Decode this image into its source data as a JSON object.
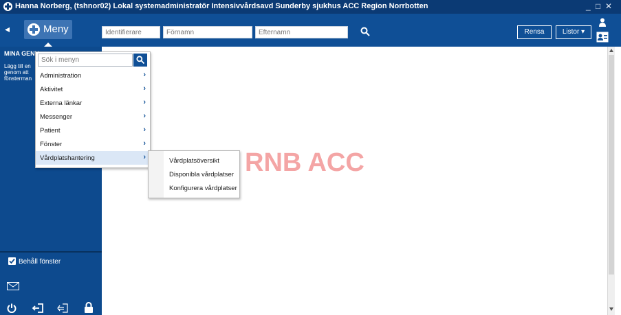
{
  "window": {
    "title": "Hanna  Norberg, (tshnor02) Lokal systemadministratör Intensivvårdsavd Sunderby sjukhus ACC Region Norrbotten",
    "minimize": "_",
    "restore": "□",
    "close": "✕"
  },
  "toolbar": {
    "collapse_arrow": "◂",
    "menu_label": "Meny",
    "id_placeholder": "Identifierare",
    "firstname_placeholder": "Förnamn",
    "lastname_placeholder": "Efternamn",
    "clear_label": "Rensa",
    "lists_label": "Listor ▾"
  },
  "sidebar": {
    "header": "MINA GENV",
    "description": "Lägg till en genom att fönsterman",
    "keep_window_label": "Behåll fönster"
  },
  "menu": {
    "search_placeholder": "Sök i menyn",
    "items": [
      {
        "label": "Administration"
      },
      {
        "label": "Aktivitet"
      },
      {
        "label": "Externa länkar"
      },
      {
        "label": "Messenger"
      },
      {
        "label": "Patient"
      },
      {
        "label": "Fönster"
      },
      {
        "label": "Vårdplatshantering"
      }
    ],
    "submenu": [
      {
        "label": "Vårdplatsöversikt"
      },
      {
        "label": "Disponibla vårdplatser"
      },
      {
        "label": "Konfigurera vårdplatser"
      }
    ]
  },
  "watermark": "RNB ACC",
  "colors": {
    "titlebar": "#0b3a74",
    "toolbar": "#0f4f96",
    "sidebar": "#0d4a8e",
    "watermark": "#f4a5a5"
  }
}
